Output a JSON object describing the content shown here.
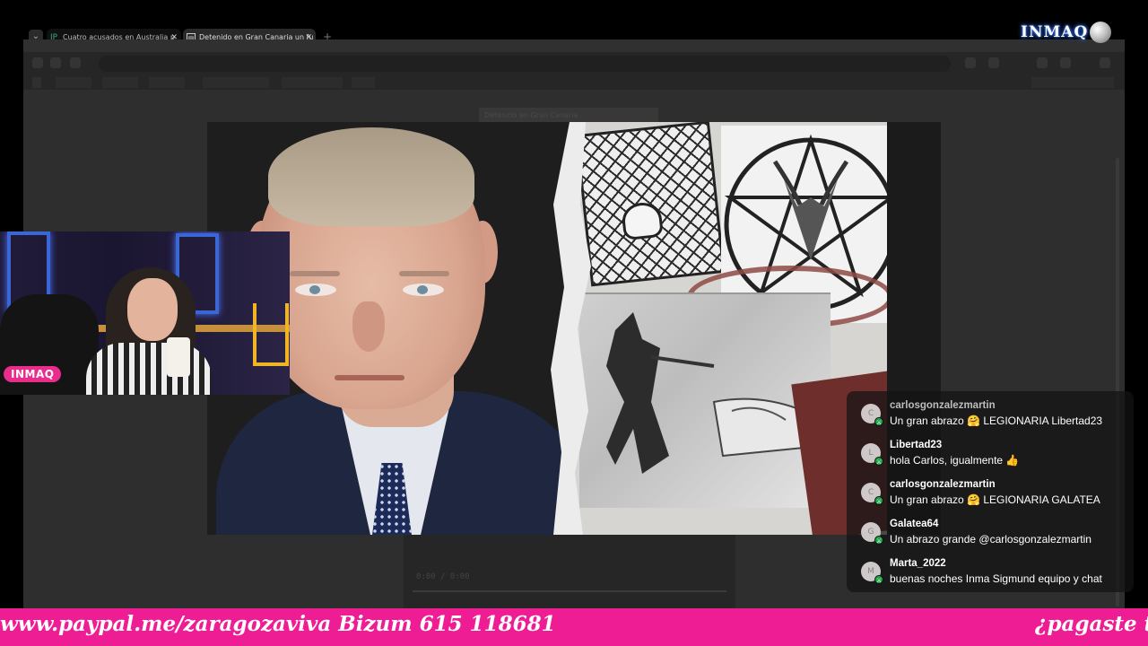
{
  "browser": {
    "tabs": [
      {
        "label": "Cuatro acusados en Australia p",
        "icon": "ip-favicon-icon",
        "active": false
      },
      {
        "label": "Detenido en Gran Canaria un fu",
        "icon": "news-favicon-icon",
        "active": true
      }
    ],
    "page_title": "Detenido en Gran Canaria",
    "video_time": "0:00 / 0:00"
  },
  "overlay": {
    "logo_text": "INMAQ",
    "webcam_badge": "INMAQ"
  },
  "chat": {
    "messages": [
      {
        "user": "carlosgonzalezmartin",
        "avatar": "C",
        "text": "Un gran abrazo 🤗 LEGIONARIA Libertad23"
      },
      {
        "user": "Libertad23",
        "avatar": "L",
        "text": "hola Carlos, igualmente 👍"
      },
      {
        "user": "carlosgonzalezmartin",
        "avatar": "C",
        "text": "Un gran abrazo 🤗 LEGIONARIA GALATEA"
      },
      {
        "user": "Galatea64",
        "avatar": "G",
        "text": "Un abrazo grande @carlosgonzalezmartin"
      },
      {
        "user": "Marta_2022",
        "avatar": "M",
        "text": "buenas noches Inma Sigmund equipo y chat"
      }
    ]
  },
  "ticker": {
    "text": "www.paypal.me/zaragozaviva Bizum 615 118681",
    "text2": "¿pagaste tu"
  },
  "colors": {
    "ticker_bg": "#ee1d94",
    "badge_bg": "#ea2d8c",
    "mod_badge": "#1fa34a"
  }
}
